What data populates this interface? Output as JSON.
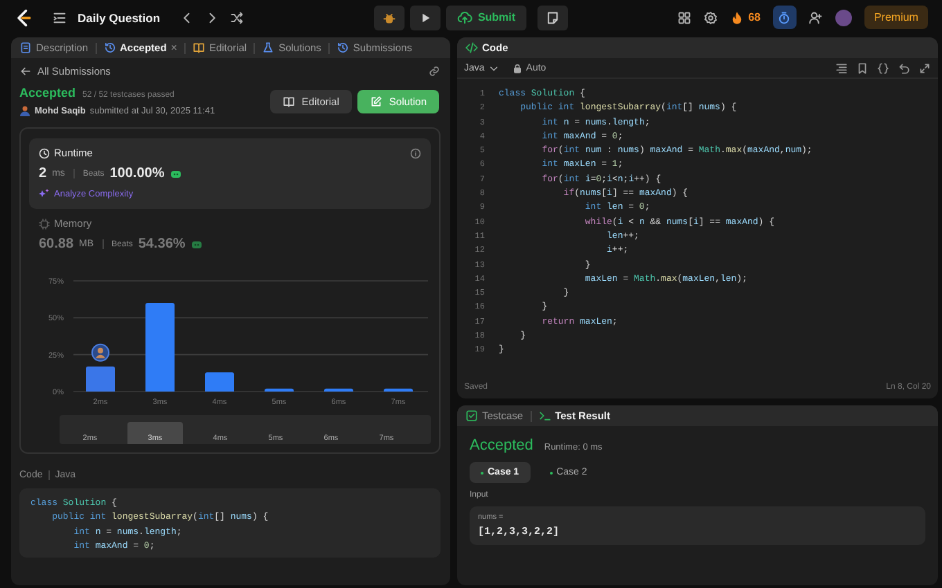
{
  "top_bar": {
    "title": "Daily Question",
    "submit": "Submit",
    "streak": "68",
    "premium": "Premium"
  },
  "left_panel": {
    "tabs": [
      {
        "label": "Description",
        "selected": false
      },
      {
        "label": "Accepted",
        "selected": true,
        "close": "×"
      },
      {
        "label": "Editorial",
        "selected": false
      },
      {
        "label": "Solutions",
        "selected": false
      },
      {
        "label": "Submissions",
        "selected": false
      }
    ],
    "back_link": "All Submissions",
    "submission": {
      "status": "Accepted",
      "testcases": "52 / 52 testcases passed",
      "author": "Mohd Saqib",
      "submitted": "submitted at Jul 30, 2025 11:41"
    },
    "buttons": [
      {
        "label": "Editorial",
        "kind": "secondary"
      },
      {
        "label": "Solution",
        "kind": "primary"
      }
    ],
    "runtime": {
      "title": "Runtime",
      "value": "2",
      "unit": "ms",
      "beats_label": "Beats",
      "beats": "100.00%",
      "analyze": "Analyze Complexity",
      "selected": true
    },
    "memory": {
      "title": "Memory",
      "value": "60.88",
      "unit": "MB",
      "beats_label": "Beats",
      "beats": "54.36%",
      "selected": false
    },
    "chart_data": {
      "type": "bar",
      "categories": [
        "2ms",
        "3ms",
        "4ms",
        "5ms",
        "6ms",
        "7ms"
      ],
      "values": [
        17,
        60,
        13,
        2,
        2,
        2
      ],
      "ylim": [
        0,
        75
      ],
      "yticks": [
        {
          "value": 0,
          "label": "0%"
        },
        {
          "value": 25,
          "label": "25%"
        },
        {
          "value": 50,
          "label": "50%"
        },
        {
          "value": 75,
          "label": "75%"
        }
      ],
      "annotations": [
        {
          "x": "2ms"
        }
      ]
    },
    "navigator": [
      {
        "label": "2ms",
        "selected": false
      },
      {
        "label": "3ms",
        "selected": true
      },
      {
        "label": "4ms",
        "selected": false
      },
      {
        "label": "5ms",
        "selected": false
      },
      {
        "label": "6ms",
        "selected": false
      },
      {
        "label": "7ms",
        "selected": false
      }
    ],
    "code_preview": {
      "label": "Code",
      "language": "Java",
      "lines": [
        [
          {
            "kind": "keyword",
            "text": "class "
          },
          {
            "kind": "type",
            "text": "Solution"
          },
          {
            "kind": "plain",
            "text": " {"
          }
        ],
        [
          {
            "kind": "keyword",
            "text": "    public int "
          },
          {
            "kind": "function",
            "text": "longestSubarray"
          },
          {
            "kind": "plain",
            "text": "("
          },
          {
            "kind": "keyword",
            "text": "int"
          },
          {
            "kind": "plain",
            "text": "[] "
          },
          {
            "kind": "variable",
            "text": "nums"
          },
          {
            "kind": "plain",
            "text": ") {"
          }
        ],
        [
          {
            "kind": "keyword",
            "text": "        int "
          },
          {
            "kind": "variable",
            "text": "n"
          },
          {
            "kind": "plain",
            "text": " = "
          },
          {
            "kind": "variable",
            "text": "nums"
          },
          {
            "kind": "plain",
            "text": "."
          },
          {
            "kind": "variable",
            "text": "length"
          },
          {
            "kind": "plain",
            "text": ";"
          }
        ],
        [
          {
            "kind": "keyword",
            "text": "        int "
          },
          {
            "kind": "variable",
            "text": "maxAnd"
          },
          {
            "kind": "plain",
            "text": " = "
          },
          {
            "kind": "number",
            "text": "0"
          },
          {
            "kind": "plain",
            "text": ";"
          }
        ]
      ]
    }
  },
  "code_panel": {
    "title": "Code",
    "language": "Java",
    "mode": "Auto",
    "lines": [
      {
        "n": "1",
        "tokens": [
          {
            "kind": "keyword",
            "text": "class "
          },
          {
            "kind": "type",
            "text": "Solution"
          },
          {
            "kind": "plain",
            "text": " {"
          }
        ]
      },
      {
        "n": "2",
        "tokens": [
          {
            "kind": "keyword",
            "text": "    public int "
          },
          {
            "kind": "function",
            "text": "longestSubarray"
          },
          {
            "kind": "plain",
            "text": "("
          },
          {
            "kind": "keyword",
            "text": "int"
          },
          {
            "kind": "plain",
            "text": "[] "
          },
          {
            "kind": "variable",
            "text": "nums"
          },
          {
            "kind": "plain",
            "text": ") {"
          }
        ]
      },
      {
        "n": "3",
        "tokens": [
          {
            "kind": "keyword",
            "text": "        int "
          },
          {
            "kind": "variable",
            "text": "n"
          },
          {
            "kind": "plain",
            "text": " = "
          },
          {
            "kind": "variable",
            "text": "nums"
          },
          {
            "kind": "plain",
            "text": "."
          },
          {
            "kind": "variable",
            "text": "length"
          },
          {
            "kind": "plain",
            "text": ";"
          }
        ]
      },
      {
        "n": "4",
        "tokens": [
          {
            "kind": "keyword",
            "text": "        int "
          },
          {
            "kind": "variable",
            "text": "maxAnd"
          },
          {
            "kind": "plain",
            "text": " = "
          },
          {
            "kind": "number",
            "text": "0"
          },
          {
            "kind": "plain",
            "text": ";"
          }
        ]
      },
      {
        "n": "5",
        "tokens": [
          {
            "kind": "control",
            "text": "        for"
          },
          {
            "kind": "plain",
            "text": "("
          },
          {
            "kind": "keyword",
            "text": "int "
          },
          {
            "kind": "variable",
            "text": "num"
          },
          {
            "kind": "plain",
            "text": " : "
          },
          {
            "kind": "variable",
            "text": "nums"
          },
          {
            "kind": "plain",
            "text": ") "
          },
          {
            "kind": "variable",
            "text": "maxAnd"
          },
          {
            "kind": "plain",
            "text": " = "
          },
          {
            "kind": "type",
            "text": "Math"
          },
          {
            "kind": "plain",
            "text": "."
          },
          {
            "kind": "function",
            "text": "max"
          },
          {
            "kind": "plain",
            "text": "("
          },
          {
            "kind": "variable",
            "text": "maxAnd"
          },
          {
            "kind": "plain",
            "text": ","
          },
          {
            "kind": "variable",
            "text": "num"
          },
          {
            "kind": "plain",
            "text": ");"
          }
        ]
      },
      {
        "n": "6",
        "tokens": [
          {
            "kind": "keyword",
            "text": "        int "
          },
          {
            "kind": "variable",
            "text": "maxLen"
          },
          {
            "kind": "plain",
            "text": " = "
          },
          {
            "kind": "number",
            "text": "1"
          },
          {
            "kind": "plain",
            "text": ";"
          }
        ]
      },
      {
        "n": "7",
        "tokens": [
          {
            "kind": "control",
            "text": "        for"
          },
          {
            "kind": "plain",
            "text": "("
          },
          {
            "kind": "keyword",
            "text": "int "
          },
          {
            "kind": "variable",
            "text": "i"
          },
          {
            "kind": "plain",
            "text": "="
          },
          {
            "kind": "number",
            "text": "0"
          },
          {
            "kind": "plain",
            "text": ";"
          },
          {
            "kind": "variable",
            "text": "i"
          },
          {
            "kind": "plain",
            "text": "<"
          },
          {
            "kind": "variable",
            "text": "n"
          },
          {
            "kind": "plain",
            "text": ";"
          },
          {
            "kind": "variable",
            "text": "i"
          },
          {
            "kind": "plain",
            "text": "++) {"
          }
        ]
      },
      {
        "n": "8",
        "tokens": [
          {
            "kind": "control",
            "text": "            if"
          },
          {
            "kind": "plain",
            "text": "("
          },
          {
            "kind": "variable",
            "text": "nums"
          },
          {
            "kind": "plain",
            "text": "["
          },
          {
            "kind": "variable",
            "text": "i"
          },
          {
            "kind": "plain",
            "text": "] == "
          },
          {
            "kind": "variable",
            "text": "maxAnd"
          },
          {
            "kind": "plain",
            "text": ") {"
          }
        ]
      },
      {
        "n": "9",
        "tokens": [
          {
            "kind": "keyword",
            "text": "                int "
          },
          {
            "kind": "variable",
            "text": "len"
          },
          {
            "kind": "plain",
            "text": " = "
          },
          {
            "kind": "number",
            "text": "0"
          },
          {
            "kind": "plain",
            "text": ";"
          }
        ]
      },
      {
        "n": "10",
        "tokens": [
          {
            "kind": "control",
            "text": "                while"
          },
          {
            "kind": "plain",
            "text": "("
          },
          {
            "kind": "variable",
            "text": "i"
          },
          {
            "kind": "plain",
            "text": " < "
          },
          {
            "kind": "variable",
            "text": "n"
          },
          {
            "kind": "plain",
            "text": " && "
          },
          {
            "kind": "variable",
            "text": "nums"
          },
          {
            "kind": "plain",
            "text": "["
          },
          {
            "kind": "variable",
            "text": "i"
          },
          {
            "kind": "plain",
            "text": "] == "
          },
          {
            "kind": "variable",
            "text": "maxAnd"
          },
          {
            "kind": "plain",
            "text": ") {"
          }
        ]
      },
      {
        "n": "11",
        "tokens": [
          {
            "kind": "variable",
            "text": "                    len"
          },
          {
            "kind": "plain",
            "text": "++;"
          }
        ]
      },
      {
        "n": "12",
        "tokens": [
          {
            "kind": "variable",
            "text": "                    i"
          },
          {
            "kind": "plain",
            "text": "++;"
          }
        ]
      },
      {
        "n": "13",
        "tokens": [
          {
            "kind": "plain",
            "text": "                }"
          }
        ]
      },
      {
        "n": "14",
        "tokens": [
          {
            "kind": "variable",
            "text": "                maxLen"
          },
          {
            "kind": "plain",
            "text": " = "
          },
          {
            "kind": "type",
            "text": "Math"
          },
          {
            "kind": "plain",
            "text": "."
          },
          {
            "kind": "function",
            "text": "max"
          },
          {
            "kind": "plain",
            "text": "("
          },
          {
            "kind": "variable",
            "text": "maxLen"
          },
          {
            "kind": "plain",
            "text": ","
          },
          {
            "kind": "variable",
            "text": "len"
          },
          {
            "kind": "plain",
            "text": ");"
          }
        ]
      },
      {
        "n": "15",
        "tokens": [
          {
            "kind": "plain",
            "text": "            }"
          }
        ]
      },
      {
        "n": "16",
        "tokens": [
          {
            "kind": "plain",
            "text": "        }"
          }
        ]
      },
      {
        "n": "17",
        "tokens": [
          {
            "kind": "control",
            "text": "        return "
          },
          {
            "kind": "variable",
            "text": "maxLen"
          },
          {
            "kind": "plain",
            "text": ";"
          }
        ]
      },
      {
        "n": "18",
        "tokens": [
          {
            "kind": "plain",
            "text": "    }"
          }
        ]
      },
      {
        "n": "19",
        "tokens": [
          {
            "kind": "plain",
            "text": "}"
          }
        ]
      }
    ],
    "status": "Saved",
    "cursor": "Ln 8, Col 20"
  },
  "test_panel": {
    "tabs": [
      {
        "label": "Testcase",
        "selected": false
      },
      {
        "label": "Test Result",
        "selected": true
      }
    ],
    "status": "Accepted",
    "runtime": "Runtime: 0 ms",
    "cases": [
      {
        "label": "Case 1",
        "selected": true
      },
      {
        "label": "Case 2",
        "selected": false
      }
    ],
    "input_label": "Input",
    "inputs": [
      {
        "name": "nums =",
        "value": "[1,2,3,3,2,2]"
      }
    ]
  }
}
